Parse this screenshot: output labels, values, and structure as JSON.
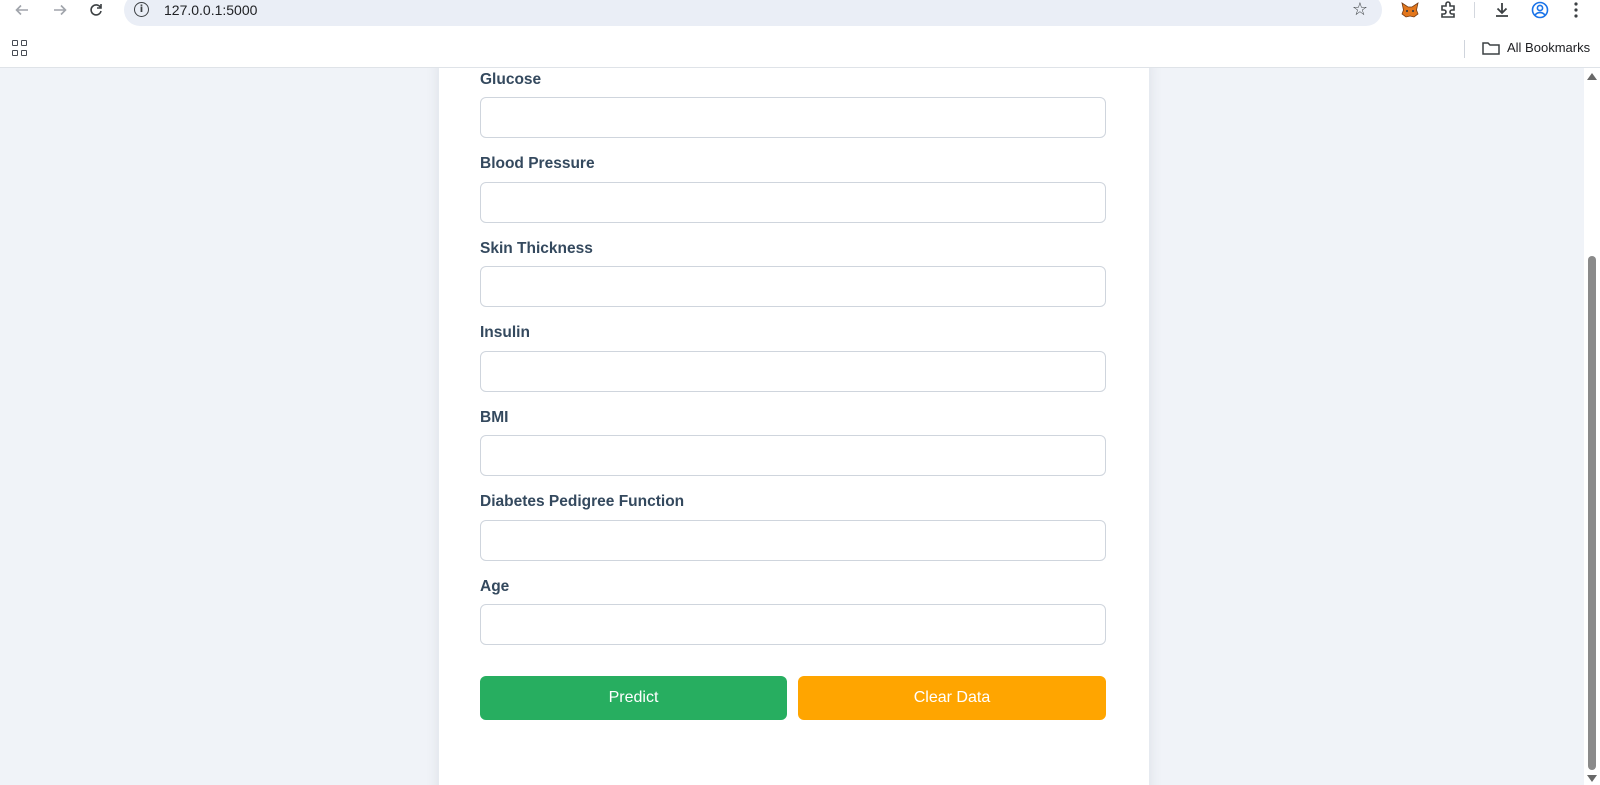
{
  "browser": {
    "url": "127.0.0.1:5000",
    "bookmarks_label": "All Bookmarks"
  },
  "form": {
    "fields": [
      {
        "label": "Glucose",
        "value": ""
      },
      {
        "label": "Blood Pressure",
        "value": ""
      },
      {
        "label": "Skin Thickness",
        "value": ""
      },
      {
        "label": "Insulin",
        "value": ""
      },
      {
        "label": "BMI",
        "value": ""
      },
      {
        "label": "Diabetes Pedigree Function",
        "value": ""
      },
      {
        "label": "Age",
        "value": ""
      }
    ],
    "predict_label": "Predict",
    "clear_label": "Clear Data"
  },
  "colors": {
    "predict_button": "#27ae60",
    "clear_button": "#ffa500",
    "page_background": "#f0f3f8",
    "label_text": "#34495e"
  },
  "icons": [
    "back-icon",
    "forward-icon",
    "reload-icon",
    "site-info-icon",
    "bookmark-star-icon",
    "metamask-extension-icon",
    "extensions-icon",
    "download-icon",
    "profile-icon",
    "more-menu-icon",
    "apps-icon",
    "folder-icon"
  ]
}
